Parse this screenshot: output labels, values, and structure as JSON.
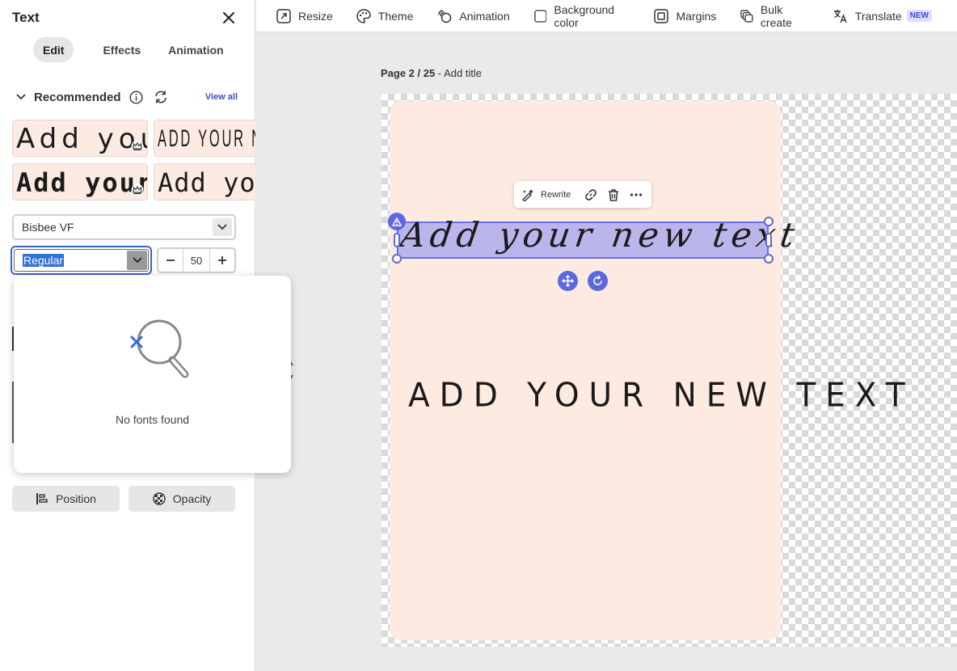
{
  "panel": {
    "title": "Text",
    "tabs": [
      "Edit",
      "Effects",
      "Animation"
    ],
    "recommended_label": "Recommended",
    "view_all": "View all",
    "presets": [
      "Add your new text",
      "ADD YOUR NEW TEXT",
      "Add your new text",
      "Add your new text"
    ],
    "font_family": "Bisbee VF",
    "font_style": "Regular",
    "font_size": "50",
    "position_label": "Position",
    "opacity_label": "Opacity"
  },
  "popup": {
    "message": "No fonts found"
  },
  "toolbar": {
    "resize": "Resize",
    "theme": "Theme",
    "animation": "Animation",
    "background_color": "Background color",
    "margins": "Margins",
    "bulk_create": "Bulk create",
    "translate": "Translate",
    "new_badge": "NEW"
  },
  "canvas": {
    "page_number": "Page 2 / 25",
    "page_title": "Add title",
    "context_rewrite": "Rewrite",
    "selected_text": "Add your new text",
    "caps_text": "ADD YOUR NEW TEXT"
  },
  "colors": {
    "accent": "#5d68e0",
    "card_bg": "#fdebe1",
    "link": "#3d4bc7",
    "selection_highlight": "#2f6fd6"
  }
}
